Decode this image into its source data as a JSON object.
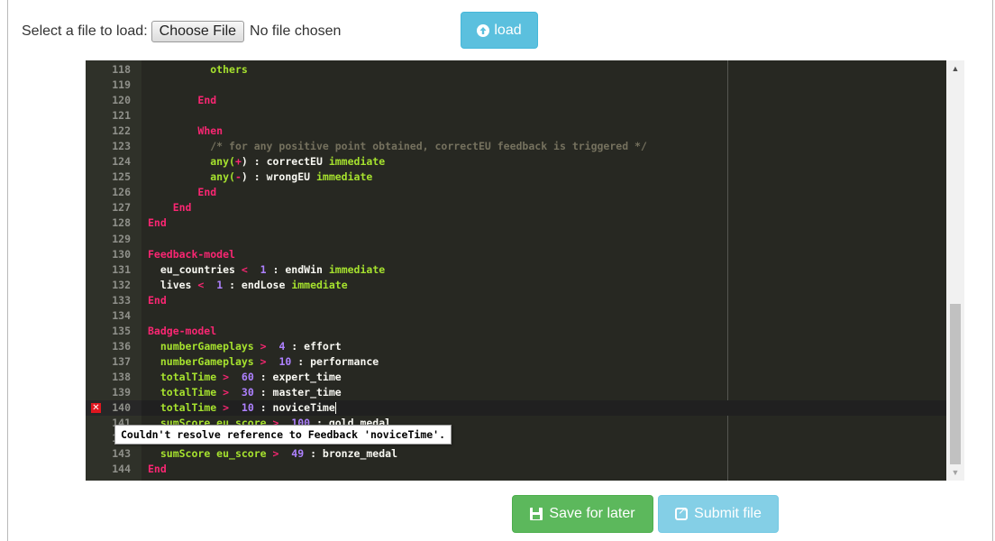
{
  "file_picker": {
    "label": "Select a file to load:",
    "button_label": "Choose File",
    "status": "No file chosen"
  },
  "load_button": {
    "label": "load",
    "icon": "circle-arrow-up-icon"
  },
  "editor": {
    "lines": [
      {
        "n": "118",
        "indent": "          ",
        "tokens": [
          {
            "t": "others",
            "c": "green"
          }
        ]
      },
      {
        "n": "119",
        "indent": "",
        "tokens": []
      },
      {
        "n": "120",
        "indent": "        ",
        "tokens": [
          {
            "t": "End",
            "c": "kw"
          }
        ]
      },
      {
        "n": "121",
        "indent": "",
        "tokens": []
      },
      {
        "n": "122",
        "indent": "        ",
        "tokens": [
          {
            "t": "When",
            "c": "kw"
          }
        ]
      },
      {
        "n": "123",
        "indent": "          ",
        "tokens": [
          {
            "t": "/* for any positive point obtained, correctEU feedback is triggered */",
            "c": "comment"
          }
        ]
      },
      {
        "n": "124",
        "indent": "          ",
        "tokens": [
          {
            "t": "any(",
            "c": "green"
          },
          {
            "t": "+",
            "c": "kw"
          },
          {
            "t": ") : correctEU ",
            "c": "white"
          },
          {
            "t": "immediate",
            "c": "green"
          }
        ]
      },
      {
        "n": "125",
        "indent": "          ",
        "tokens": [
          {
            "t": "any(",
            "c": "green"
          },
          {
            "t": "-",
            "c": "kw"
          },
          {
            "t": ") : wrongEU ",
            "c": "white"
          },
          {
            "t": "immediate",
            "c": "green"
          }
        ]
      },
      {
        "n": "126",
        "indent": "        ",
        "tokens": [
          {
            "t": "End",
            "c": "kw"
          }
        ]
      },
      {
        "n": "127",
        "indent": "    ",
        "tokens": [
          {
            "t": "End",
            "c": "kw"
          }
        ]
      },
      {
        "n": "128",
        "indent": "",
        "tokens": [
          {
            "t": "End",
            "c": "kw"
          }
        ]
      },
      {
        "n": "129",
        "indent": "",
        "tokens": []
      },
      {
        "n": "130",
        "indent": "",
        "tokens": [
          {
            "t": "Feedback-model",
            "c": "kw"
          }
        ]
      },
      {
        "n": "131",
        "indent": "  ",
        "tokens": [
          {
            "t": "eu_countries ",
            "c": "white"
          },
          {
            "t": "<",
            "c": "kw"
          },
          {
            "t": "  ",
            "c": "white"
          },
          {
            "t": "1",
            "c": "num"
          },
          {
            "t": " : endWin ",
            "c": "white"
          },
          {
            "t": "immediate",
            "c": "green"
          }
        ]
      },
      {
        "n": "132",
        "indent": "  ",
        "tokens": [
          {
            "t": "lives ",
            "c": "white"
          },
          {
            "t": "<",
            "c": "kw"
          },
          {
            "t": "  ",
            "c": "white"
          },
          {
            "t": "1",
            "c": "num"
          },
          {
            "t": " : endLose ",
            "c": "white"
          },
          {
            "t": "immediate",
            "c": "green"
          }
        ]
      },
      {
        "n": "133",
        "indent": "",
        "tokens": [
          {
            "t": "End",
            "c": "kw"
          }
        ]
      },
      {
        "n": "134",
        "indent": "",
        "tokens": []
      },
      {
        "n": "135",
        "indent": "",
        "tokens": [
          {
            "t": "Badge-model",
            "c": "kw"
          }
        ]
      },
      {
        "n": "136",
        "indent": "  ",
        "tokens": [
          {
            "t": "numberGameplays ",
            "c": "green"
          },
          {
            "t": ">",
            "c": "kw"
          },
          {
            "t": "  ",
            "c": "white"
          },
          {
            "t": "4",
            "c": "num"
          },
          {
            "t": " : effort",
            "c": "white"
          }
        ]
      },
      {
        "n": "137",
        "indent": "  ",
        "tokens": [
          {
            "t": "numberGameplays ",
            "c": "green"
          },
          {
            "t": ">",
            "c": "kw"
          },
          {
            "t": "  ",
            "c": "white"
          },
          {
            "t": "10",
            "c": "num"
          },
          {
            "t": " : performance",
            "c": "white"
          }
        ]
      },
      {
        "n": "138",
        "indent": "  ",
        "tokens": [
          {
            "t": "totalTime ",
            "c": "green"
          },
          {
            "t": ">",
            "c": "kw"
          },
          {
            "t": "  ",
            "c": "white"
          },
          {
            "t": "60",
            "c": "num"
          },
          {
            "t": " : expert_time",
            "c": "white"
          }
        ]
      },
      {
        "n": "139",
        "indent": "  ",
        "tokens": [
          {
            "t": "totalTime ",
            "c": "green"
          },
          {
            "t": ">",
            "c": "kw"
          },
          {
            "t": "  ",
            "c": "white"
          },
          {
            "t": "30",
            "c": "num"
          },
          {
            "t": " : master_time",
            "c": "white"
          }
        ]
      },
      {
        "n": "140",
        "indent": "  ",
        "error": true,
        "active": true,
        "tokens": [
          {
            "t": "totalTime ",
            "c": "green"
          },
          {
            "t": ">",
            "c": "kw"
          },
          {
            "t": "  ",
            "c": "white"
          },
          {
            "t": "10",
            "c": "num"
          },
          {
            "t": " : noviceTime",
            "c": "white"
          }
        ]
      },
      {
        "n": "141",
        "indent": "  ",
        "tokens": [
          {
            "t": "sumScore eu_score ",
            "c": "green"
          },
          {
            "t": ">",
            "c": "kw"
          },
          {
            "t": "  ",
            "c": "white"
          },
          {
            "t": "100",
            "c": "num"
          },
          {
            "t": " : gold_medal",
            "c": "white"
          }
        ]
      },
      {
        "n": "142",
        "indent": "",
        "tokens": []
      },
      {
        "n": "143",
        "indent": "  ",
        "tokens": [
          {
            "t": "sumScore eu_score ",
            "c": "green"
          },
          {
            "t": ">",
            "c": "kw"
          },
          {
            "t": "  ",
            "c": "white"
          },
          {
            "t": "49",
            "c": "num"
          },
          {
            "t": " : bronze_medal",
            "c": "white"
          }
        ]
      },
      {
        "n": "144",
        "indent": "",
        "tokens": [
          {
            "t": "End",
            "c": "kw"
          }
        ]
      }
    ],
    "error_tooltip": "Couldn't resolve reference to Feedback 'noviceTime'."
  },
  "actions": {
    "save_label": "Save for later",
    "submit_label": "Submit file"
  },
  "colors": {
    "editor_bg": "#272822",
    "keyword": "#f92672",
    "identifier": "#a6e22e",
    "number": "#ae81ff",
    "save_button": "#5cb85c",
    "info_button": "#5bc0de",
    "error": "#e0161f"
  }
}
